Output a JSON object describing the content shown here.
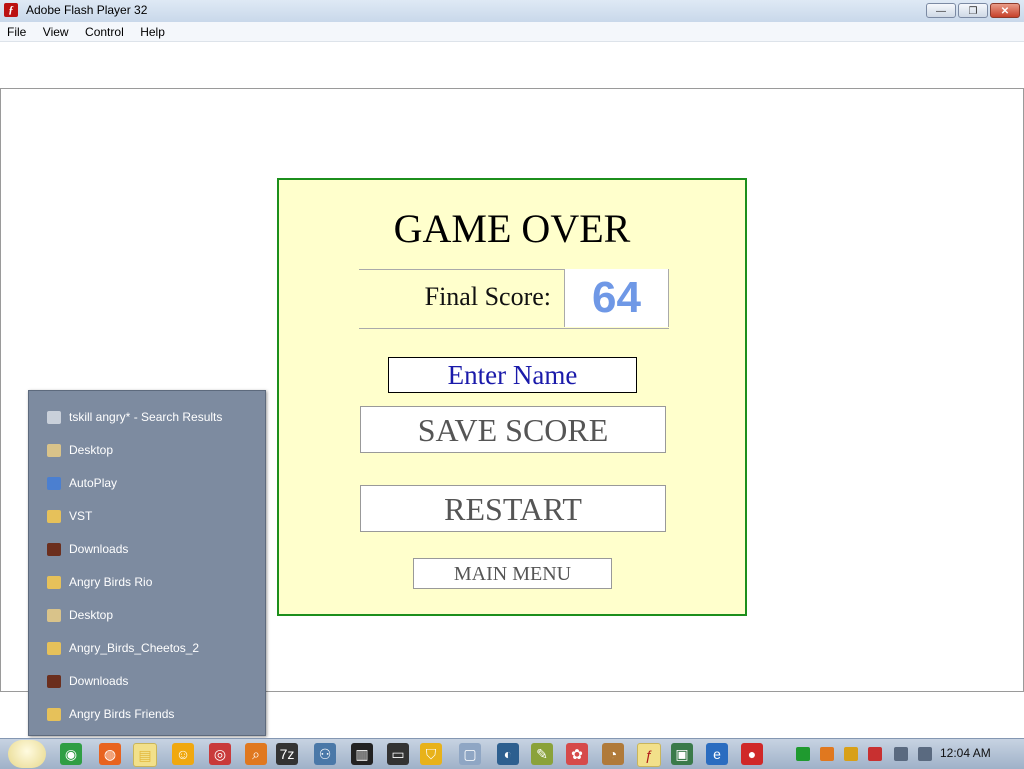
{
  "window": {
    "title": "Adobe Flash Player 32",
    "minimize": "—",
    "maximize": "❐",
    "close": "✕"
  },
  "menu": [
    "File",
    "View",
    "Control",
    "Help"
  ],
  "game": {
    "title": "GAME OVER",
    "score_label": "Final Score:",
    "score_value": "64",
    "name_placeholder": "Enter Name",
    "save_label": "SAVE SCORE",
    "restart_label": "RESTART",
    "main_menu_label": "MAIN MENU"
  },
  "jumplist": [
    {
      "label": "tskill angry* - Search Results",
      "icon": "search-folder-icon",
      "color": "#c9d0da"
    },
    {
      "label": "Desktop",
      "icon": "desktop-folder-icon",
      "color": "#d9c38a"
    },
    {
      "label": "AutoPlay",
      "icon": "autoplay-icon",
      "color": "#4b7fd0"
    },
    {
      "label": "VST",
      "icon": "folder-icon",
      "color": "#e6c15a"
    },
    {
      "label": "Downloads",
      "icon": "downloads-folder-icon",
      "color": "#6b2e1d"
    },
    {
      "label": "Angry Birds Rio",
      "icon": "folder-icon",
      "color": "#e6c15a"
    },
    {
      "label": "Desktop",
      "icon": "desktop-folder-icon",
      "color": "#d9c38a"
    },
    {
      "label": "Angry_Birds_Cheetos_2",
      "icon": "folder-icon",
      "color": "#e6c15a"
    },
    {
      "label": "Downloads",
      "icon": "downloads-folder-icon",
      "color": "#6b2e1d"
    },
    {
      "label": "Angry Birds Friends",
      "icon": "folder-icon",
      "color": "#e6c15a"
    }
  ],
  "taskbar": {
    "apps": [
      {
        "name": "chrome-icon",
        "color": "#2f9e44",
        "glyph": "◉"
      },
      {
        "name": "firefox-icon",
        "color": "#e8631f",
        "glyph": "◍"
      },
      {
        "name": "explorer-folder-icon",
        "color": "#e3b83f",
        "glyph": "▤",
        "active": true
      },
      {
        "name": "messenger-icon",
        "color": "#f0a80f",
        "glyph": "☺"
      },
      {
        "name": "camera-icon",
        "color": "#c93a3a",
        "glyph": "◎"
      },
      {
        "name": "search-tool-icon",
        "color": "#e0781f",
        "glyph": "⌕"
      },
      {
        "name": "7zip-icon",
        "color": "#333333",
        "glyph": "7z"
      },
      {
        "name": "network-icon",
        "color": "#4a78a8",
        "glyph": "⚇"
      },
      {
        "name": "audio-mixer-icon",
        "color": "#222222",
        "glyph": "▥"
      },
      {
        "name": "console-icon",
        "color": "#333333",
        "glyph": "▭"
      },
      {
        "name": "security-shield-icon",
        "color": "#e8b21a",
        "glyph": "⛉"
      },
      {
        "name": "window-icon",
        "color": "#8fa6c4",
        "glyph": "▢"
      },
      {
        "name": "globe-icon",
        "color": "#2d5f8f",
        "glyph": "◐"
      },
      {
        "name": "notepad-icon",
        "color": "#8aa23a",
        "glyph": "✎"
      },
      {
        "name": "paint-icon",
        "color": "#d64a4a",
        "glyph": "✿"
      },
      {
        "name": "palette-icon",
        "color": "#b07a3a",
        "glyph": "◔"
      },
      {
        "name": "flash-player-icon",
        "color": "#b01818",
        "glyph": "ƒ",
        "active": true
      },
      {
        "name": "monitor-icon",
        "color": "#3a7a4a",
        "glyph": "▣"
      },
      {
        "name": "browser-icon",
        "color": "#2a6cc0",
        "glyph": "e"
      },
      {
        "name": "angry-bird-icon",
        "color": "#d02828",
        "glyph": "●"
      }
    ],
    "tray": [
      {
        "name": "battery-icon",
        "color": "#1f9a2f"
      },
      {
        "name": "tray-search-icon",
        "color": "#e0781f"
      },
      {
        "name": "messenger-tray-icon",
        "color": "#d8a018"
      },
      {
        "name": "network-error-icon",
        "color": "#c83030"
      },
      {
        "name": "display-icon",
        "color": "#5a6a80"
      },
      {
        "name": "volume-icon",
        "color": "#5a6a80"
      }
    ],
    "clock": "12:04 AM"
  }
}
